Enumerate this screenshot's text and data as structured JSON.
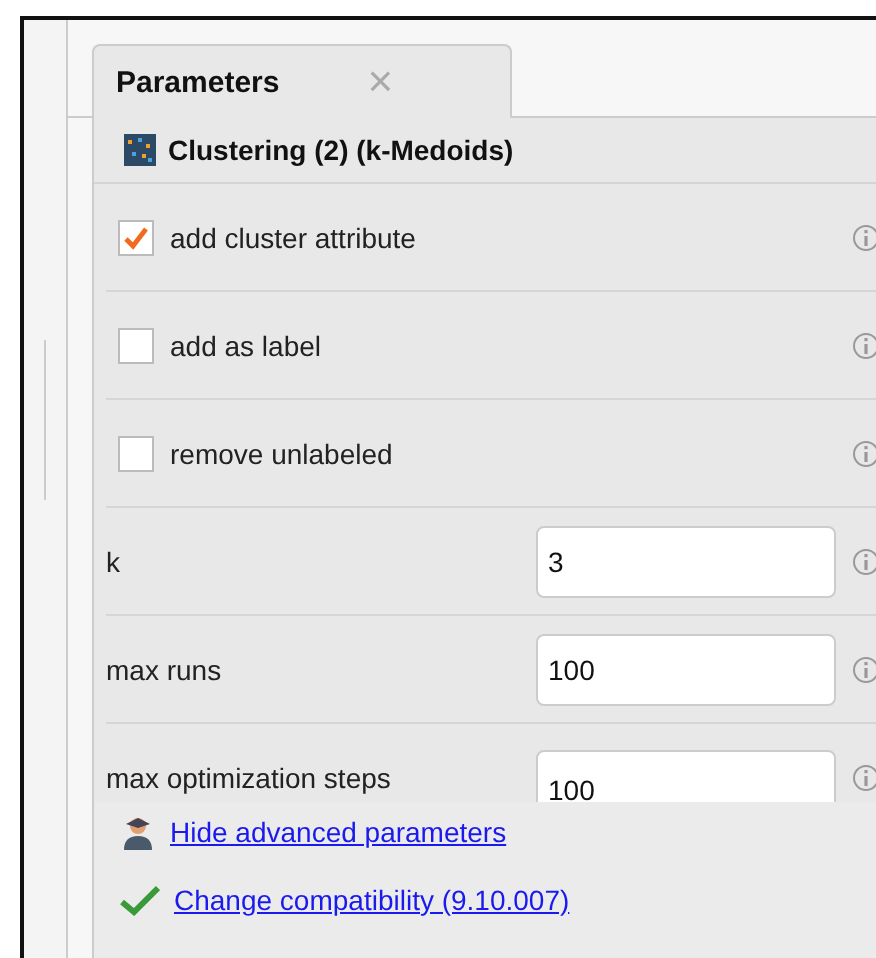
{
  "tab": {
    "label": "Parameters",
    "close": "×"
  },
  "operator": {
    "title": "Clustering (2) (k-Medoids)"
  },
  "parameters": [
    {
      "kind": "checkbox",
      "label": "add cluster attribute",
      "checked": true
    },
    {
      "kind": "checkbox",
      "label": "add as label",
      "checked": false
    },
    {
      "kind": "checkbox",
      "label": "remove unlabeled",
      "checked": false
    },
    {
      "kind": "number",
      "label": "k",
      "value": "3"
    },
    {
      "kind": "number",
      "label": "max runs",
      "value": "100"
    },
    {
      "kind": "number",
      "label": "max optimization steps",
      "value": "100"
    }
  ],
  "links": [
    {
      "kind": "advanced",
      "label": "Hide advanced parameters"
    },
    {
      "kind": "compat",
      "label": "Change compatibility (9.10.007)"
    }
  ]
}
